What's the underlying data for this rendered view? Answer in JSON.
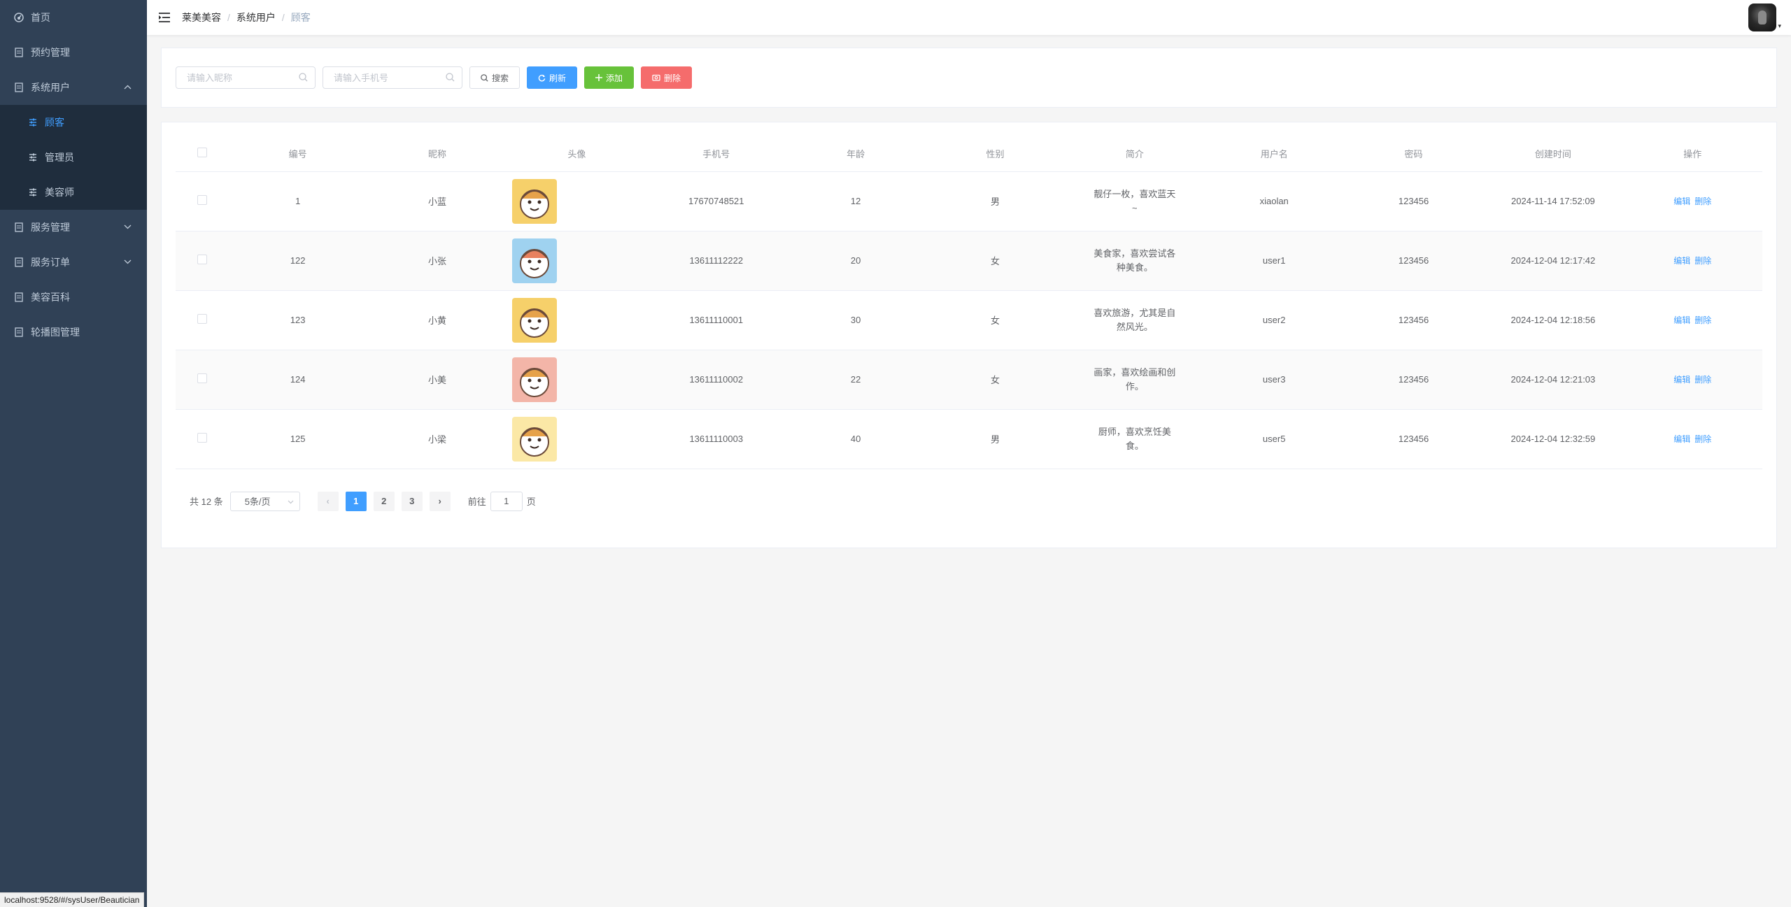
{
  "sidebar": {
    "items": [
      {
        "label": "首页",
        "icon": "dashboard-icon"
      },
      {
        "label": "预约管理",
        "icon": "document-icon"
      },
      {
        "label": "系统用户",
        "icon": "document-icon",
        "expanded": true,
        "children": [
          {
            "label": "顾客",
            "active": true
          },
          {
            "label": "管理员"
          },
          {
            "label": "美容师"
          }
        ]
      },
      {
        "label": "服务管理",
        "icon": "document-icon"
      },
      {
        "label": "服务订单",
        "icon": "document-icon"
      },
      {
        "label": "美容百科",
        "icon": "document-icon"
      },
      {
        "label": "轮播图管理",
        "icon": "document-icon"
      }
    ]
  },
  "header": {
    "breadcrumb": [
      "莱美美容",
      "系统用户",
      "顾客"
    ],
    "breadcrumb_sep": "/",
    "caret": "▾"
  },
  "toolbar": {
    "nickname_placeholder": "请输入昵称",
    "phone_placeholder": "请输入手机号",
    "search_label": "搜索",
    "refresh_label": "刷新",
    "add_label": "添加",
    "delete_label": "删除"
  },
  "table": {
    "columns": [
      "编号",
      "昵称",
      "头像",
      "手机号",
      "年龄",
      "性别",
      "简介",
      "用户名",
      "密码",
      "创建时间",
      "操作"
    ],
    "rows": [
      {
        "id": "1",
        "nickname": "小蓝",
        "phone": "17670748521",
        "age": "12",
        "gender": "男",
        "intro": "靓仔一枚，喜欢蓝天~",
        "username": "xiaolan",
        "password": "123456",
        "created": "2024-11-14 17:52:09",
        "avatar_color": "#f6d06a"
      },
      {
        "id": "122",
        "nickname": "小张",
        "phone": "13611112222",
        "age": "20",
        "gender": "女",
        "intro": "美食家，喜欢尝试各种美食。",
        "username": "user1",
        "password": "123456",
        "created": "2024-12-04 12:17:42",
        "avatar_color": "#9fd2f0"
      },
      {
        "id": "123",
        "nickname": "小黄",
        "phone": "13611110001",
        "age": "30",
        "gender": "女",
        "intro": "喜欢旅游，尤其是自然风光。",
        "username": "user2",
        "password": "123456",
        "created": "2024-12-04 12:18:56",
        "avatar_color": "#f6d06a"
      },
      {
        "id": "124",
        "nickname": "小美",
        "phone": "13611110002",
        "age": "22",
        "gender": "女",
        "intro": "画家，喜欢绘画和创作。",
        "username": "user3",
        "password": "123456",
        "created": "2024-12-04 12:21:03",
        "avatar_color": "#f3b5a8"
      },
      {
        "id": "125",
        "nickname": "小梁",
        "phone": "13611110003",
        "age": "40",
        "gender": "男",
        "intro": "厨师，喜欢烹饪美食。",
        "username": "user5",
        "password": "123456",
        "created": "2024-12-04 12:32:59",
        "avatar_color": "#fbe8a6"
      }
    ],
    "edit_label": "编辑",
    "delete_label": "删除"
  },
  "pagination": {
    "total_text": "共 12 条",
    "page_size": "5条/页",
    "pages": [
      "1",
      "2",
      "3"
    ],
    "current_page": "1",
    "prev": "‹",
    "next": "›",
    "goto_prefix": "前往",
    "goto_value": "1",
    "goto_suffix": "页"
  },
  "status_bar": {
    "url": "localhost:9528/#/sysUser/Beautician"
  },
  "colors": {
    "sidebar_bg": "#304156",
    "submenu_bg": "#1f2d3d",
    "accent": "#409eff",
    "success": "#67c23a",
    "danger": "#f56c6c"
  }
}
